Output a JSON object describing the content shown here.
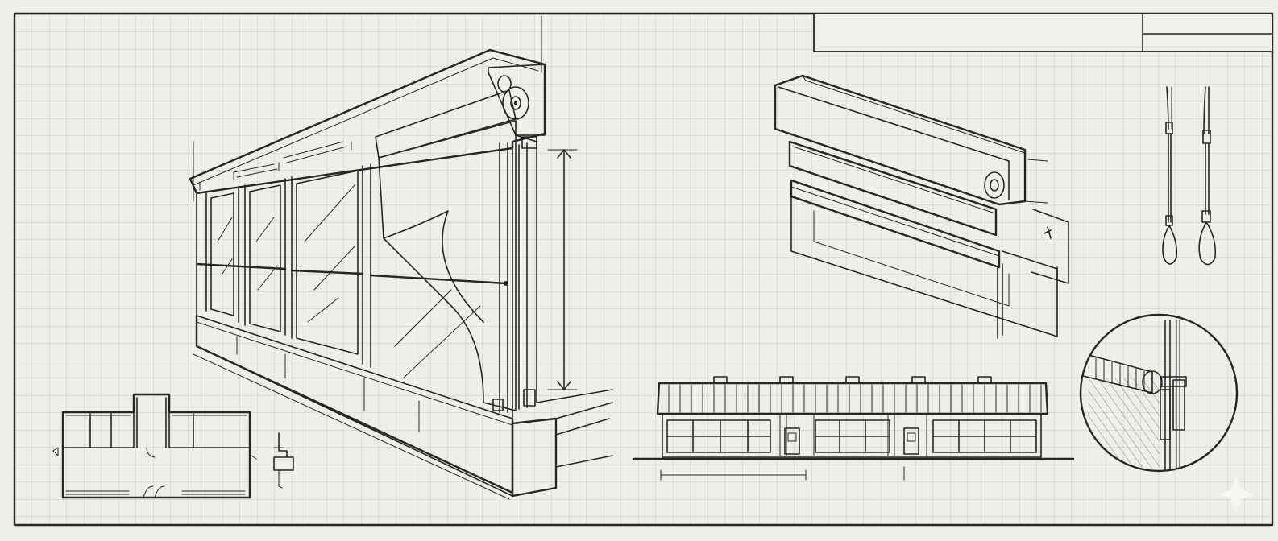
{
  "sheet": {
    "grid": true,
    "colors": {
      "paper": "#eeeeea",
      "grid": "#c9ccd0",
      "ink": "#262626"
    }
  },
  "title_block": {
    "title": "",
    "field_1": "",
    "field_2": ""
  },
  "views": [
    {
      "id": "main-isometric",
      "kind": "isometric window wall with roller shade"
    },
    {
      "id": "floor-plan",
      "kind": "floor plan"
    },
    {
      "id": "cassette-detail",
      "kind": "exploded shade cassette"
    },
    {
      "id": "cable-guides",
      "kind": "guide cables"
    },
    {
      "id": "front-elevation",
      "kind": "building elevation"
    },
    {
      "id": "circular-detail",
      "kind": "enlarged detail"
    }
  ]
}
